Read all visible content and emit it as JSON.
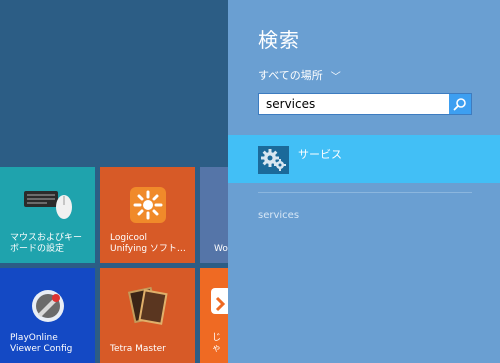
{
  "start": {
    "tiles": [
      {
        "label": "マウスおよびキー\nボードの設定",
        "icon": "mouse-keyboard-icon"
      },
      {
        "label": "Logicool\nUnifying ソフト…",
        "icon": "unifying-logo-icon"
      },
      {
        "label": "Wo",
        "icon": ""
      },
      {
        "label": "PlayOnline\nViewer Config",
        "icon": "playonline-icon"
      },
      {
        "label": "Tetra Master",
        "icon": "tetra-master-icon"
      },
      {
        "label": "じゃ",
        "icon": "app-icon"
      }
    ]
  },
  "charm": {
    "title": "検索",
    "scope_label": "すべての場所",
    "scope_chevron": "﹀",
    "search_value": "services",
    "results": [
      {
        "label": "サービス",
        "icon": "services-gear-icon"
      }
    ],
    "suggestions": [
      "services"
    ]
  },
  "colors": {
    "charm_bg": "#6a9fd2",
    "selected_result": "#42bff6",
    "search_button": "#3d9ff1"
  }
}
